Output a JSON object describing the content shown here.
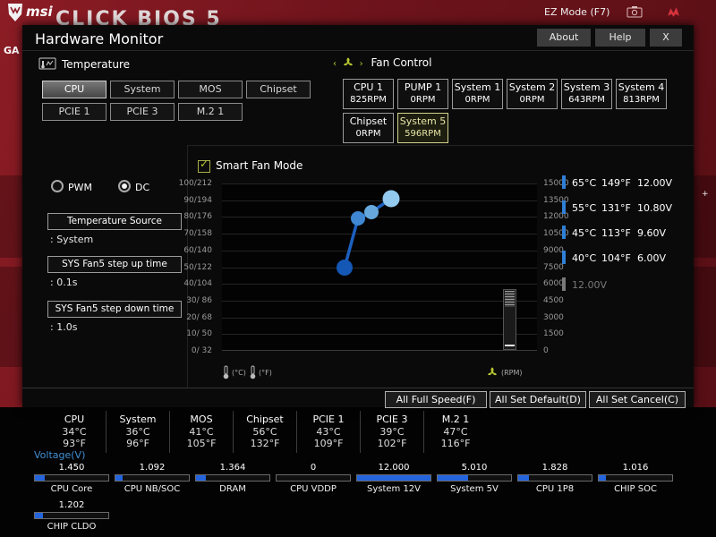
{
  "background": {
    "edge_text": "GA"
  },
  "top_bar": {
    "logo_text": "msi",
    "bios_title": "CLICK BIOS 5",
    "ez_mode_label": "EZ Mode (F7)",
    "icons": [
      "screenshot-icon",
      "dragon-icon"
    ]
  },
  "window": {
    "title": "Hardware Monitor",
    "about_label": "About",
    "help_label": "Help",
    "close_label": "X"
  },
  "temperature_section": {
    "label": "Temperature",
    "buttons": [
      {
        "label": "CPU",
        "selected": true
      },
      {
        "label": "System",
        "selected": false
      },
      {
        "label": "MOS",
        "selected": false
      },
      {
        "label": "Chipset",
        "selected": false
      },
      {
        "label": "PCIE 1",
        "selected": false
      },
      {
        "label": "PCIE 3",
        "selected": false
      },
      {
        "label": "M.2 1",
        "selected": false
      }
    ]
  },
  "fan_section": {
    "label": "Fan Control",
    "fans": [
      {
        "name": "CPU 1",
        "rpm": "825RPM",
        "selected": false
      },
      {
        "name": "PUMP 1",
        "rpm": "0RPM",
        "selected": false
      },
      {
        "name": "System 1",
        "rpm": "0RPM",
        "selected": false
      },
      {
        "name": "System 2",
        "rpm": "0RPM",
        "selected": false
      },
      {
        "name": "System 3",
        "rpm": "643RPM",
        "selected": false
      },
      {
        "name": "System 4",
        "rpm": "813RPM",
        "selected": false
      },
      {
        "name": "Chipset",
        "rpm": "0RPM",
        "selected": false
      },
      {
        "name": "System 5",
        "rpm": "596RPM",
        "selected": true
      }
    ]
  },
  "controls": {
    "pwm_label": "PWM",
    "dc_label": "DC",
    "selected_mode": "DC",
    "temp_source_label": "Temperature Source",
    "temp_source_value": ": System",
    "step_up_label": "SYS Fan5 step up time",
    "step_up_value": ": 0.1s",
    "step_down_label": "SYS Fan5 step down time",
    "step_down_value": ": 1.0s",
    "smart_fan_label": "Smart Fan Mode",
    "smart_fan_checked": true
  },
  "chart_data": {
    "type": "line",
    "title": "Smart Fan Mode",
    "grid": true,
    "ylim_left": [
      0,
      100
    ],
    "ylim_right": [
      0,
      15000
    ],
    "left_ticks": [
      "100/212",
      "90/194",
      "80/176",
      "70/158",
      "60/140",
      "50/122",
      "40/104",
      "30/ 86",
      "20/ 68",
      "10/ 50",
      "0/ 32"
    ],
    "right_ticks": [
      "15000",
      "13500",
      "12000",
      "10500",
      "9000",
      "7500",
      "6000",
      "4500",
      "3000",
      "1500",
      "0"
    ],
    "celsius_label": "(°C)",
    "fahrenheit_label": "(°F)",
    "rpm_label": "(RPM)",
    "points": [
      {
        "temp_c": 40,
        "temp_f": 104,
        "voltage": "6.00V"
      },
      {
        "temp_c": 45,
        "temp_f": 113,
        "voltage": "9.60V"
      },
      {
        "temp_c": 55,
        "temp_f": 131,
        "voltage": "10.80V"
      },
      {
        "temp_c": 65,
        "temp_f": 149,
        "voltage": "12.00V"
      }
    ]
  },
  "fan_points_panel": {
    "rows": [
      {
        "c": "65°C",
        "f": "149°F",
        "v": "12.00V"
      },
      {
        "c": "55°C",
        "f": "131°F",
        "v": "10.80V"
      },
      {
        "c": "45°C",
        "f": "113°F",
        "v": "9.60V"
      },
      {
        "c": "40°C",
        "f": "104°F",
        "v": "6.00V"
      }
    ],
    "disabled_value": "12.00V"
  },
  "action_buttons": {
    "full_speed": "All Full Speed(F)",
    "set_default": "All Set Default(D)",
    "set_cancel": "All Set Cancel(C)"
  },
  "status": {
    "temps": [
      {
        "name": "CPU",
        "c": "34°C",
        "f": "93°F"
      },
      {
        "name": "System",
        "c": "36°C",
        "f": "96°F"
      },
      {
        "name": "MOS",
        "c": "41°C",
        "f": "105°F"
      },
      {
        "name": "Chipset",
        "c": "56°C",
        "f": "132°F"
      },
      {
        "name": "PCIE 1",
        "c": "43°C",
        "f": "109°F"
      },
      {
        "name": "PCIE 3",
        "c": "39°C",
        "f": "102°F"
      },
      {
        "name": "M.2 1",
        "c": "47°C",
        "f": "116°F"
      }
    ],
    "voltage_label": "Voltage(V)",
    "voltages": [
      {
        "name": "CPU Core",
        "value": "1.450",
        "fill": 13
      },
      {
        "name": "CPU NB/SOC",
        "value": "1.092",
        "fill": 10
      },
      {
        "name": "DRAM",
        "value": "1.364",
        "fill": 13
      },
      {
        "name": "CPU VDDP",
        "value": "0",
        "fill": 0
      },
      {
        "name": "System 12V",
        "value": "12.000",
        "fill": 100
      },
      {
        "name": "System 5V",
        "value": "5.010",
        "fill": 42
      },
      {
        "name": "CPU 1P8",
        "value": "1.828",
        "fill": 15
      },
      {
        "name": "CHIP SOC",
        "value": "1.016",
        "fill": 10
      },
      {
        "name": "CHIP CLDO",
        "value": "1.202",
        "fill": 11
      }
    ]
  }
}
